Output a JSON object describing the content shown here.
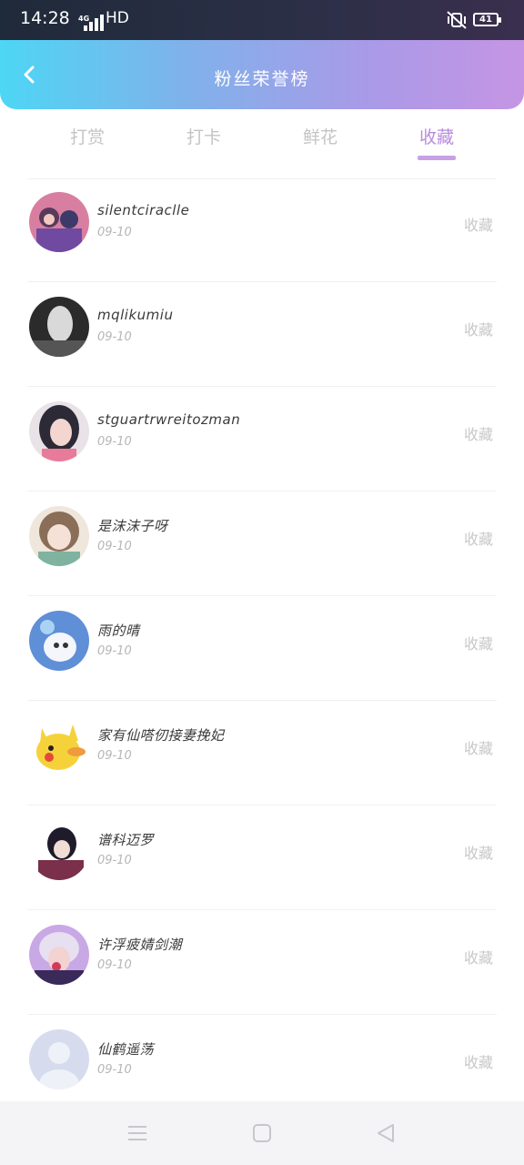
{
  "status": {
    "time": "14:28",
    "network": "4G",
    "hd": "HD",
    "battery": "41"
  },
  "header": {
    "title": "粉丝荣誉榜",
    "back_icon": "chevron-left-icon"
  },
  "tabs": [
    {
      "label": "打赏",
      "active": false
    },
    {
      "label": "打卡",
      "active": false
    },
    {
      "label": "鲜花",
      "active": false
    },
    {
      "label": "收藏",
      "active": true
    }
  ],
  "fans": [
    {
      "name": "silentciraclle",
      "date": "09-10",
      "action": "收藏"
    },
    {
      "name": "mqlikumiu",
      "date": "09-10",
      "action": "收藏"
    },
    {
      "name": "stguartrwreitozman",
      "date": "09-10",
      "action": "收藏"
    },
    {
      "name": "是沫沫子呀",
      "date": "09-10",
      "action": "收藏"
    },
    {
      "name": "雨的晴",
      "date": "09-10",
      "action": "收藏"
    },
    {
      "name": "家有仙嗒仞接妻挽妃",
      "date": "09-10",
      "action": "收藏"
    },
    {
      "name": "谱科迈罗",
      "date": "09-10",
      "action": "收藏"
    },
    {
      "name": "许浮疲婧剑潮",
      "date": "09-10",
      "action": "收藏"
    },
    {
      "name": "仙鹤遥荡",
      "date": "09-10",
      "action": "收藏"
    }
  ],
  "colors": {
    "header_start": "#4dd6f5",
    "header_end": "#c595e4",
    "active_tab": "#b98bdc"
  }
}
